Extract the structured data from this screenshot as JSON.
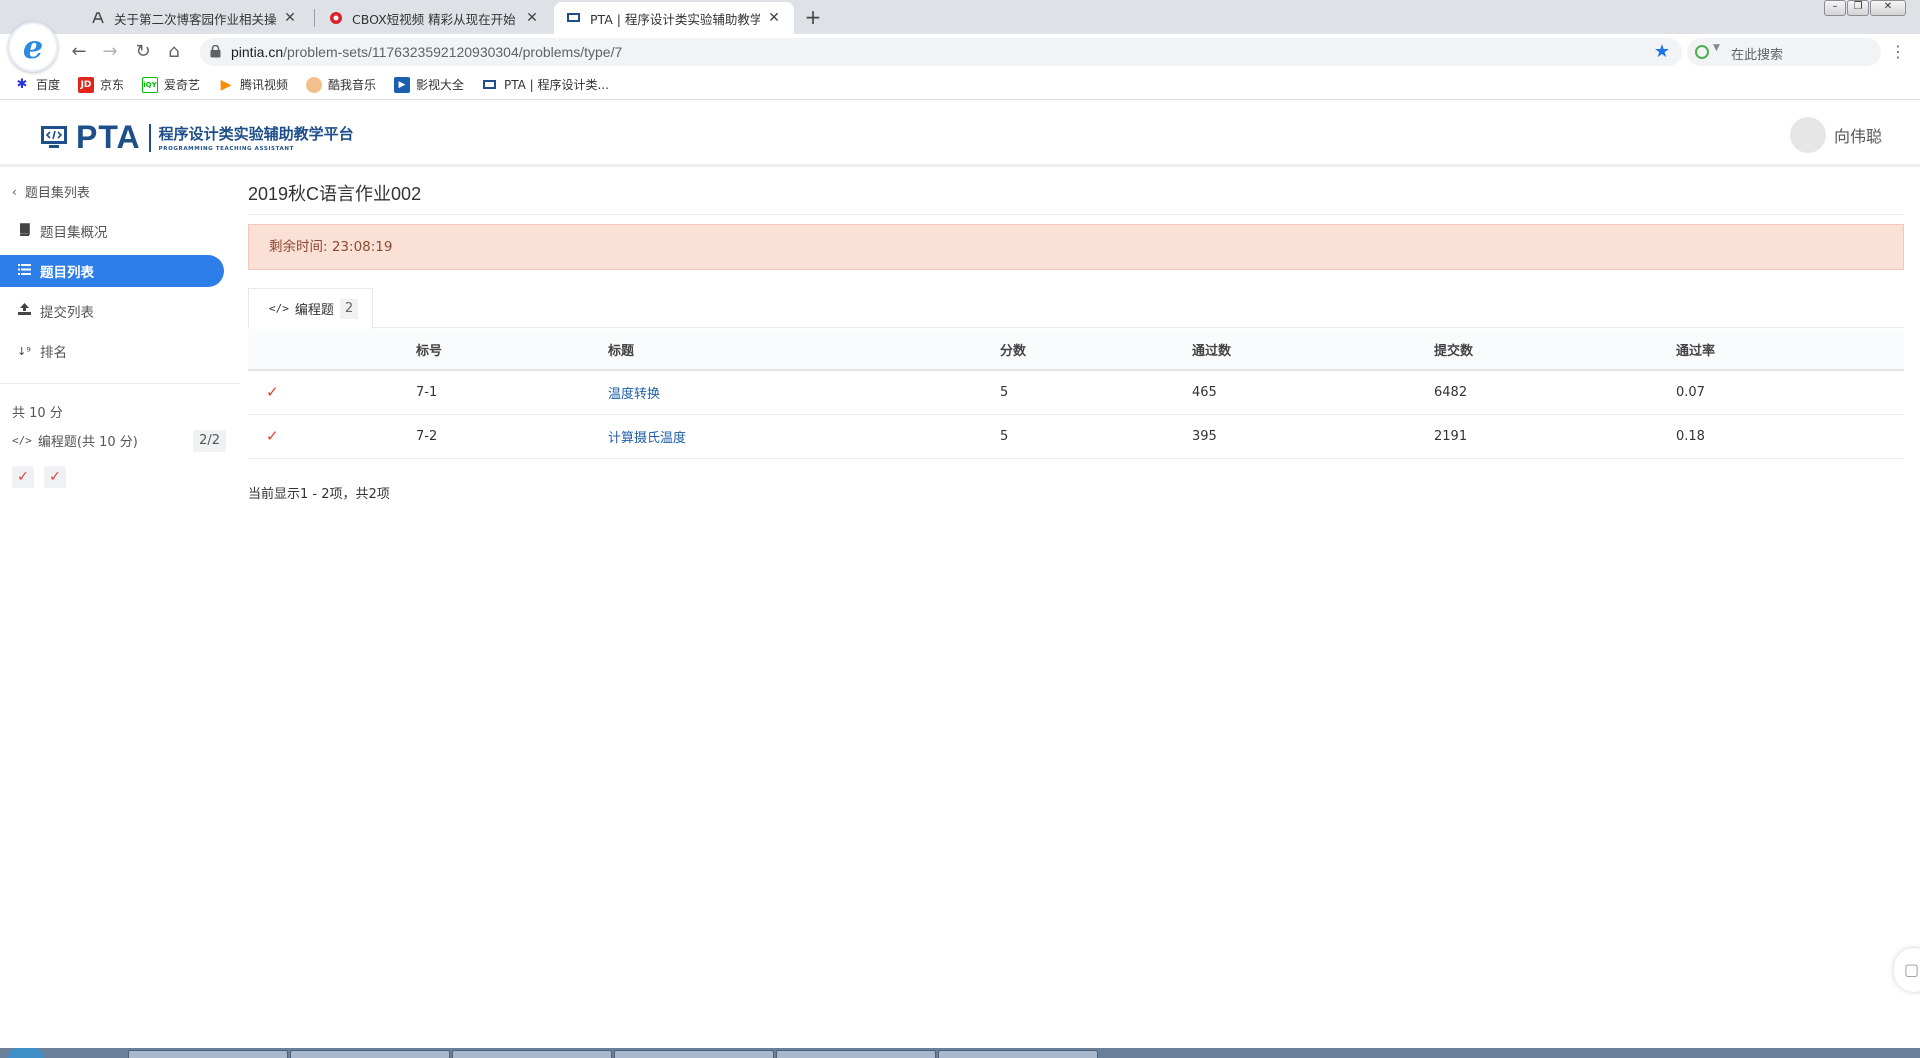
{
  "browser": {
    "tabs": [
      {
        "title": "关于第二次博客园作业相关操作"
      },
      {
        "title": "CBOX短视频 精彩从现在开始"
      },
      {
        "title": "PTA | 程序设计类实验辅助教学平"
      }
    ],
    "url_host": "pintia.cn",
    "url_path": "/problem-sets/1176323592120930304/problems/type/7",
    "search_placeholder": "在此搜索",
    "bookmarks": [
      {
        "label": "百度"
      },
      {
        "label": "京东"
      },
      {
        "label": "爱奇艺"
      },
      {
        "label": "腾讯视频"
      },
      {
        "label": "酷我音乐"
      },
      {
        "label": "影视大全"
      },
      {
        "label": "PTA | 程序设计类..."
      }
    ]
  },
  "header": {
    "logo_text": "PTA",
    "logo_title": "程序设计类实验辅助教学平台",
    "logo_subtitle": "PROGRAMMING TEACHING ASSISTANT",
    "username": "向伟聪"
  },
  "sidebar": {
    "back_label": "题目集列表",
    "items": [
      {
        "label": "题目集概况"
      },
      {
        "label": "题目列表"
      },
      {
        "label": "提交列表"
      },
      {
        "label": "排名"
      }
    ],
    "total_score": "共 10 分",
    "type_label": "编程题(共 10 分)",
    "type_count": "2/2"
  },
  "main": {
    "title": "2019秋C语言作业002",
    "timer_text": "剩余时间: 23:08:19",
    "tab_label": "编程题",
    "tab_count": "2",
    "columns": [
      "标号",
      "标题",
      "分数",
      "通过数",
      "提交数",
      "通过率"
    ],
    "rows": [
      {
        "id": "7-1",
        "title": "温度转换",
        "score": "5",
        "passed": "465",
        "submitted": "6482",
        "rate": "0.07"
      },
      {
        "id": "7-2",
        "title": "计算摄氏温度",
        "score": "5",
        "passed": "395",
        "submitted": "2191",
        "rate": "0.18"
      }
    ],
    "pagination": "当前显示1 - 2项，共2项"
  },
  "colors": {
    "accent": "#2d7ee8",
    "brand": "#1e4f8a",
    "timer_bg": "#fbe0d6",
    "check": "#e23d2d",
    "link": "#1f5fa8"
  },
  "icons": {
    "status": "check-icon",
    "nav_back": "chevron-left-icon",
    "overview": "book-icon",
    "list": "list-icon",
    "submissions": "upload-icon",
    "ranking": "sort-icon",
    "coding": "code-icon"
  }
}
